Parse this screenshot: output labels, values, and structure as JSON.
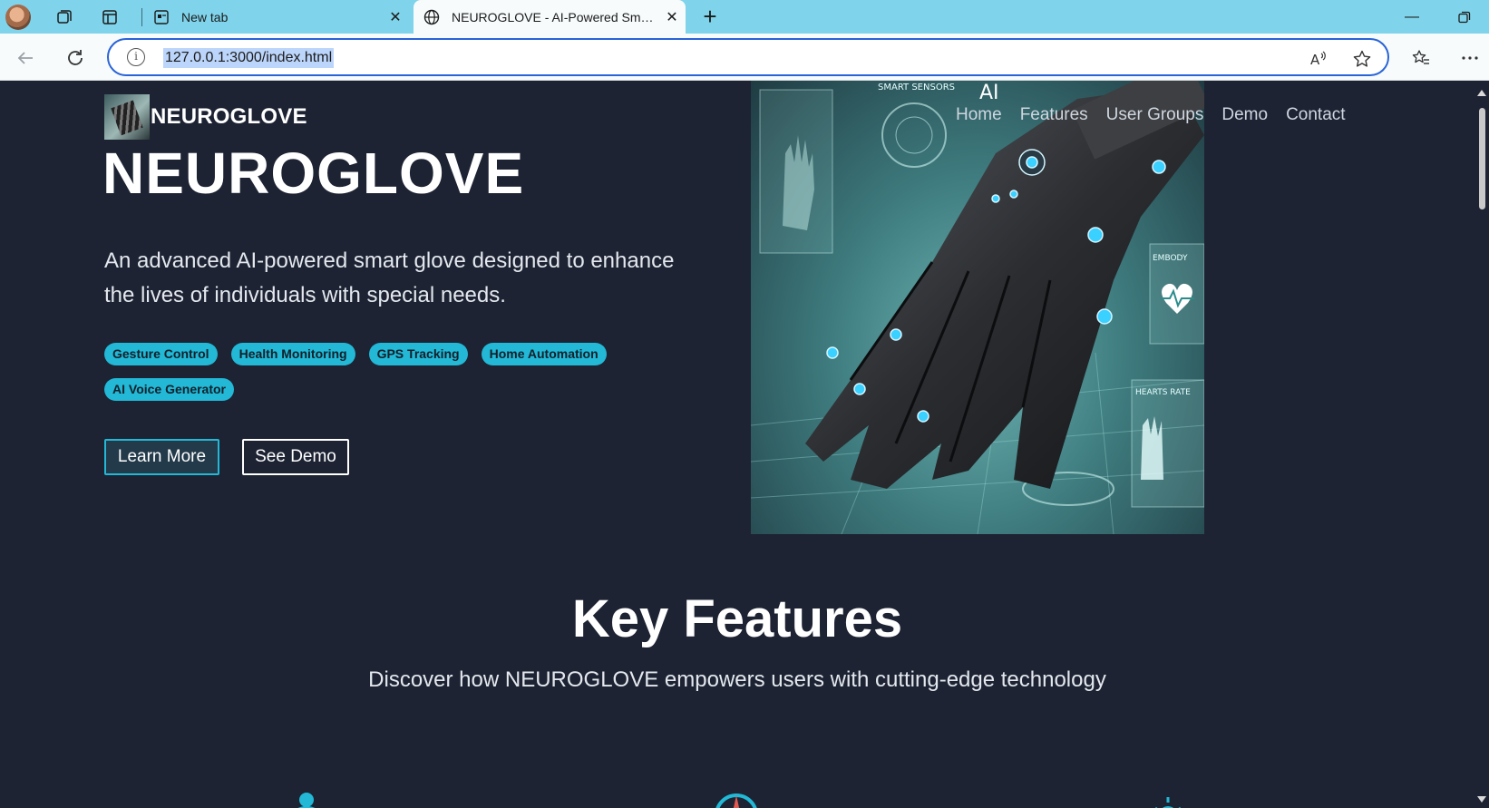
{
  "browser": {
    "tabs": [
      {
        "title": "New tab",
        "active": false
      },
      {
        "title": "NEUROGLOVE - AI-Powered Smart Glove",
        "active": true
      }
    ],
    "url": "127.0.0.1:3000/index.html"
  },
  "page": {
    "logo_text": "NEUROGLOVE",
    "nav": [
      "Home",
      "Features",
      "User Groups",
      "Demo",
      "Contact"
    ],
    "hero": {
      "title": "NEUROGLOVE",
      "description": "An advanced AI-powered smart glove designed to enhance the lives of individuals with special needs.",
      "tags": [
        "Gesture Control",
        "Health Monitoring",
        "GPS Tracking",
        "Home Automation",
        "AI Voice Generator"
      ],
      "primary_button": "Learn More",
      "secondary_button": "See Demo",
      "image_overlay_text": {
        "sensors": "SMART SENSORS",
        "ai": "AI",
        "embodied": "EMBODY",
        "hearts": "HEARTS RATE"
      }
    },
    "features": {
      "title": "Key Features",
      "subtitle": "Discover how NEUROGLOVE empowers users with cutting-edge technology"
    }
  },
  "colors": {
    "page_bg": "#1d2333",
    "accent": "#22b8d6",
    "tabbar": "#7fd3ea",
    "omnibox_border": "#2a63d8"
  }
}
